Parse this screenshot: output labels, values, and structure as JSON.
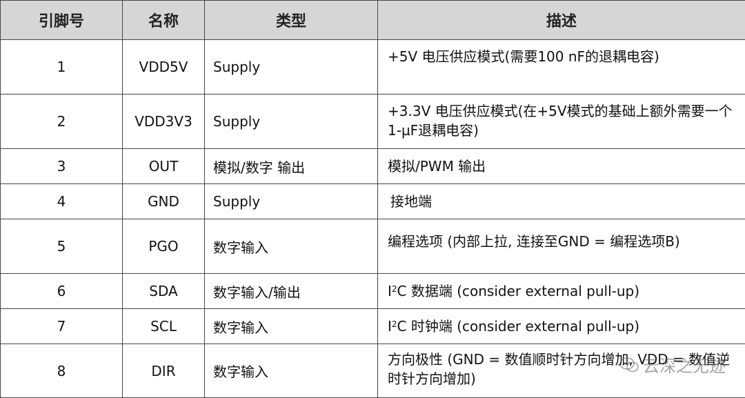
{
  "headers": [
    "引脚号",
    "名称",
    "类型",
    "描述"
  ],
  "rows": [
    {
      "pin": "1",
      "name": "VDD5V",
      "type": "Supply",
      "desc": "+5V 电压供应模式(需要100 nF的退耦电容)"
    },
    {
      "pin": "2",
      "name": "VDD3V3",
      "type": "Supply",
      "desc": "+3.3V 电压供应模式(在+5V模式的基础上额外需要一个1-µF退耦电容)"
    },
    {
      "pin": "3",
      "name": "OUT",
      "type": "模拟/数字 输出",
      "desc": "模拟/PWM 输出"
    },
    {
      "pin": "4",
      "name": "GND",
      "type": "Supply",
      "desc": "接地端"
    },
    {
      "pin": "5",
      "name": "PGO",
      "type": "数字输入",
      "desc": "编程选项 (内部上拉, 连接至GND = 编程选项B)"
    },
    {
      "pin": "6",
      "name": "SDA",
      "type": "数字输入/输出",
      "desc_prefix": "I",
      "desc_sup": "2",
      "desc": "C 数据端 (consider external pull-up)"
    },
    {
      "pin": "7",
      "name": "SCL",
      "type": "数字输入",
      "desc_prefix": "I",
      "desc_sup": "2",
      "desc": "C 时钟端 (consider external pull-up)"
    },
    {
      "pin": "8",
      "name": "DIR",
      "type": "数字输入",
      "desc": "方向极性 (GND = 数值顺时针方向增加, VDD = 数值逆时针方向增加)"
    }
  ],
  "watermark": {
    "text": "云深之无迹",
    "icon": "wechat-icon"
  }
}
